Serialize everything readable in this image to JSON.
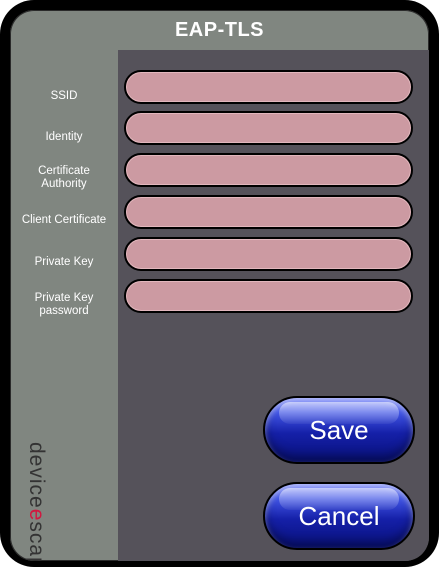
{
  "window": {
    "title": "EAP-TLS"
  },
  "form": {
    "fields": [
      {
        "label": "SSID",
        "value": "",
        "placeholder": ""
      },
      {
        "label": "Identity",
        "value": "",
        "placeholder": ""
      },
      {
        "label": "Certificate Authority",
        "value": "",
        "placeholder": ""
      },
      {
        "label": "Client Certificate",
        "value": "",
        "placeholder": ""
      },
      {
        "label": "Private Key",
        "value": "",
        "placeholder": ""
      },
      {
        "label": "Private Key password",
        "value": "",
        "placeholder": ""
      }
    ]
  },
  "buttons": {
    "save_label": "Save",
    "cancel_label": "Cancel"
  },
  "logo": {
    "prefix": "device",
    "accent": "e",
    "suffix": "scape",
    "mark": "®",
    "accent_color": "#d1173f"
  },
  "colors": {
    "frame": "#000000",
    "sidebar": "#808680",
    "panel": "#55525a",
    "input_fill": "#cc9aa2",
    "button_blue": "#1520a8"
  }
}
